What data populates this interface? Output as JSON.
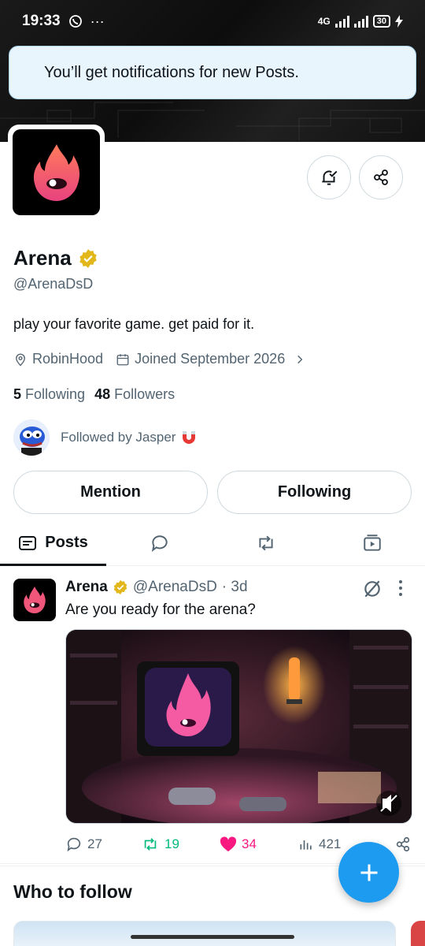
{
  "status_bar": {
    "time": "19:33",
    "network": "4G",
    "battery": "30"
  },
  "toast": {
    "text": "You’ll get notifications for new Posts."
  },
  "profile": {
    "name": "Arena",
    "handle": "@ArenaDsD",
    "bio": "play your favorite game. get paid for it.",
    "location": "RobinHood",
    "joined": "Joined September 2026",
    "following_count": "5",
    "following_label": "Following",
    "followers_count": "48",
    "followers_label": "Followers",
    "followed_by": "Followed by Jasper"
  },
  "buttons": {
    "mention": "Mention",
    "following": "Following"
  },
  "tabs": [
    {
      "label": "Posts",
      "icon": "posts-icon"
    },
    {
      "label": "",
      "icon": "replies-icon"
    },
    {
      "label": "",
      "icon": "reposts-icon"
    },
    {
      "label": "",
      "icon": "media-icon"
    }
  ],
  "post": {
    "name": "Arena",
    "handle": "@ArenaDsD",
    "time": "· 3d",
    "text": "Are you ready for the arena?",
    "replies": "27",
    "reposts": "19",
    "likes": "34",
    "views": "421"
  },
  "who_to_follow": {
    "title": "Who to follow"
  },
  "colors": {
    "accent": "#1d9bf0",
    "like": "#f91880",
    "repost": "#00ba7c",
    "verified": "#e2b719"
  }
}
